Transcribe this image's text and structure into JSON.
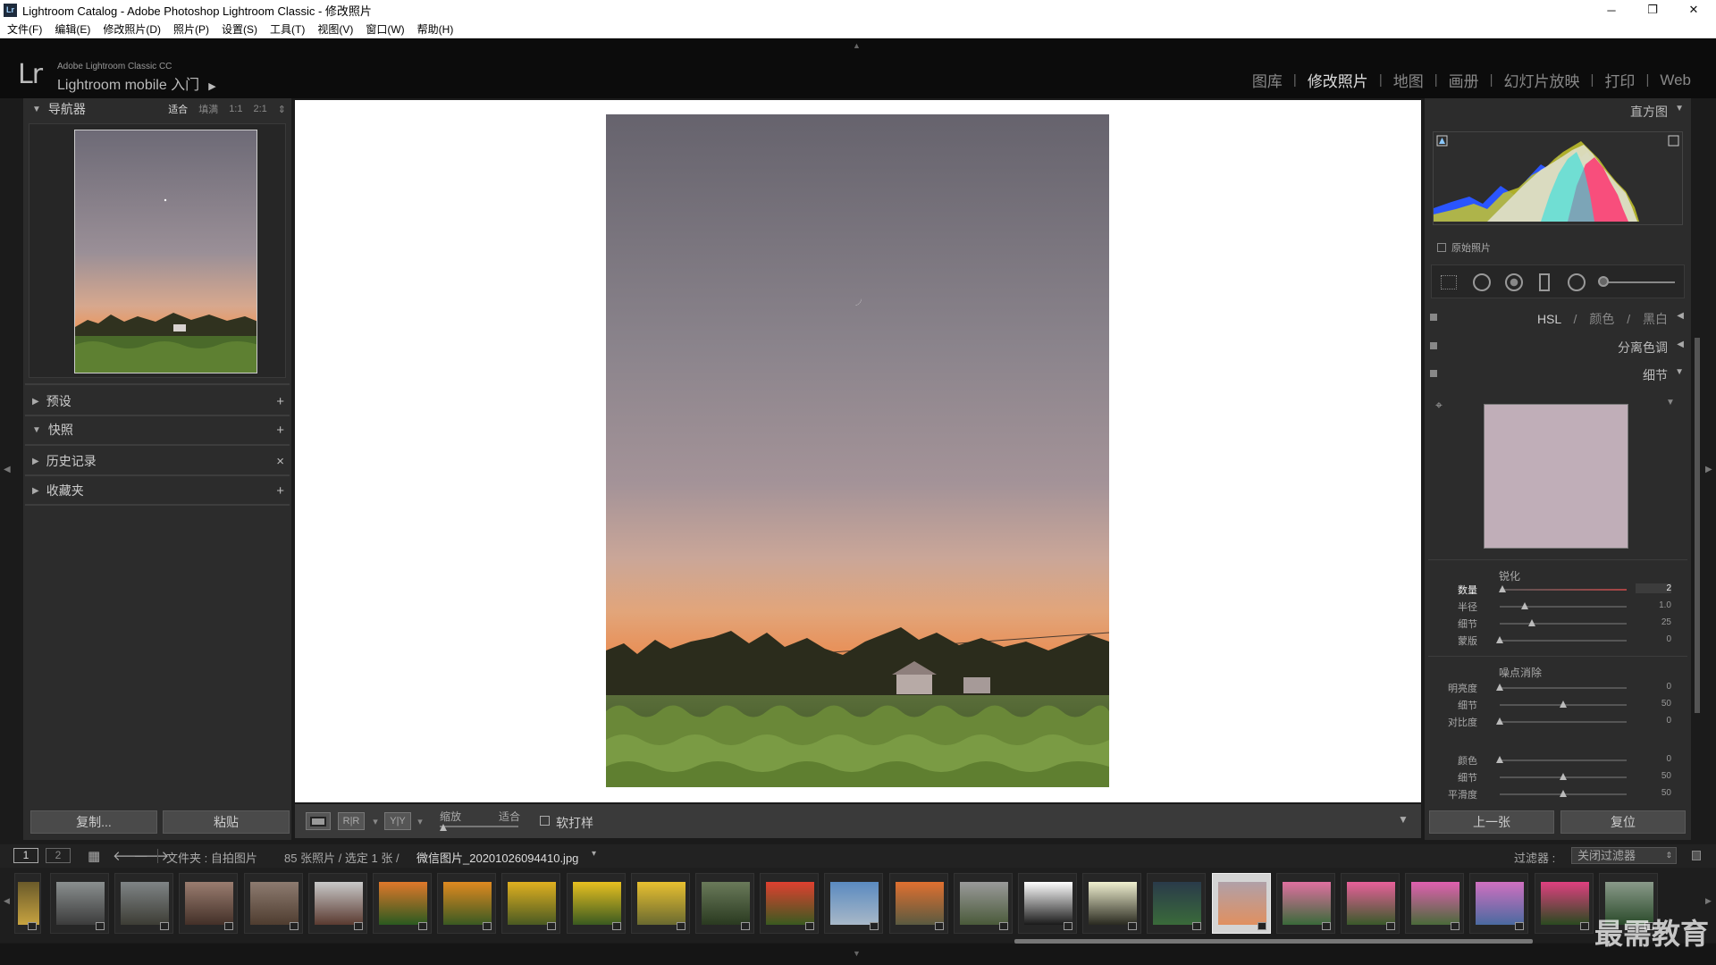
{
  "window": {
    "title": "Lightroom Catalog - Adobe Photoshop Lightroom Classic - 修改照片",
    "app_icon": "Lr",
    "controls": [
      "minimize-icon",
      "restore-icon",
      "close-icon"
    ]
  },
  "menu": [
    "文件(F)",
    "编辑(E)",
    "修改照片(D)",
    "照片(P)",
    "设置(S)",
    "工具(T)",
    "视图(V)",
    "窗口(W)",
    "帮助(H)"
  ],
  "identity": {
    "logo": "Lr",
    "line1": "Adobe Lightroom Classic CC",
    "line2": "Lightroom mobile 入门"
  },
  "modules": [
    "图库",
    "修改照片",
    "地图",
    "画册",
    "幻灯片放映",
    "打印",
    "Web"
  ],
  "active_module": "修改照片",
  "left": {
    "navigator": {
      "title": "导航器",
      "zoom": [
        "适合",
        "填满",
        "1:1",
        "2:1"
      ]
    },
    "panels": [
      {
        "title": "预设",
        "action": "+"
      },
      {
        "title": "快照",
        "action": "+"
      },
      {
        "title": "历史记录",
        "action": "×"
      },
      {
        "title": "收藏夹",
        "action": "+"
      }
    ],
    "copy_label": "复制...",
    "paste_label": "粘贴"
  },
  "toolbar": {
    "zoom_label": "缩放",
    "fit_label": "适合",
    "softproof_label": "软打样"
  },
  "right": {
    "histogram_title": "直方图",
    "original_photo_label": "原始照片",
    "hsl_tabs": [
      "HSL",
      "颜色",
      "黑白"
    ],
    "split_toning": "分离色调",
    "detail": "细节",
    "sharpen_title": "锐化",
    "sharpen": [
      {
        "label": "数量",
        "value": "2",
        "pos": 0.02
      },
      {
        "label": "半径",
        "value": "1.0",
        "pos": 0.2
      },
      {
        "label": "细节",
        "value": "25",
        "pos": 0.25
      },
      {
        "label": "蒙版",
        "value": "0",
        "pos": 0.0
      }
    ],
    "noise_title": "噪点消除",
    "noise_luma": [
      {
        "label": "明亮度",
        "value": "0",
        "pos": 0.0
      },
      {
        "label": "细节",
        "value": "50",
        "pos": 0.5
      },
      {
        "label": "对比度",
        "value": "0",
        "pos": 0.0
      }
    ],
    "noise_color": [
      {
        "label": "颜色",
        "value": "0",
        "pos": 0.0
      },
      {
        "label": "细节",
        "value": "50",
        "pos": 0.5
      },
      {
        "label": "平滑度",
        "value": "50",
        "pos": 0.5
      }
    ],
    "prev_label": "上一张",
    "reset_label": "复位"
  },
  "filmbar": {
    "page1": "1",
    "page2": "2",
    "source": "文件夹 : 自拍图片",
    "count": "85 张照片 / 选定 1 张 /",
    "filename": "微信图片_20201026094410.jpg",
    "filter_label": "过滤器 :",
    "filter_value": "关闭过滤器"
  },
  "watermark": "最需教育",
  "colors": {
    "accent_active": "#dedede",
    "panel_bg": "#2c2c2c",
    "canvas": "#ffffff"
  }
}
